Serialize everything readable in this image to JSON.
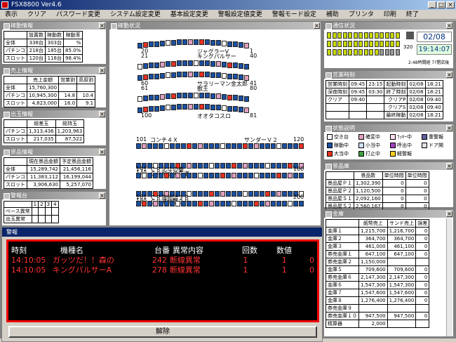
{
  "app": {
    "title": "FSX8800 Ver4.6"
  },
  "menu": [
    "表示",
    "クリア",
    "パスワード変更",
    "システム設定変更",
    "基本設定変更",
    "警報設定値変更",
    "警報モード設定",
    "補助",
    "プリンタ",
    "印刷",
    "終了"
  ],
  "kado": {
    "title": "稼動情報",
    "headers": [
      "",
      "設置数",
      "稼動数",
      "稼動率"
    ],
    "rows": [
      [
        "全体",
        "338台",
        "303台",
        "%"
      ],
      [
        "パチンコ",
        "218台",
        "185台",
        "85.0%"
      ],
      [
        "スロット",
        "120台",
        "118台",
        "98.4%"
      ]
    ]
  },
  "uriage": {
    "title": "売上情報",
    "headers": [
      "",
      "売上金額",
      "営業割",
      "高原割"
    ],
    "rows": [
      [
        "全体",
        "15,760,300",
        "",
        ""
      ],
      [
        "パチンコ",
        "10,945,300",
        "14.8",
        "10.4"
      ],
      [
        "スロット",
        "4,823,000",
        "16.0",
        "9.1"
      ]
    ]
  },
  "dedama": {
    "title": "出玉情報",
    "headers": [
      "",
      "総差玉",
      "総持玉"
    ],
    "rows": [
      [
        "パチンコ",
        "1,313,436",
        "1,203,963"
      ],
      [
        "スロット",
        "217,035",
        "87,522"
      ]
    ]
  },
  "keihin": {
    "title": "景品情報",
    "headers": [
      "",
      "現在景品金額",
      "予定景品金額"
    ],
    "rows": [
      [
        "全体",
        "15,289,742",
        "21,456,116"
      ],
      [
        "パチンコ",
        "11,383,112",
        "16,199,044"
      ],
      [
        "スロット",
        "3,906,630",
        "5,257,070"
      ]
    ]
  },
  "keiho": {
    "title": "警報台",
    "headers": [
      "",
      "1",
      "2",
      "3",
      "4"
    ],
    "rows": [
      [
        "ベース異常",
        "",
        "",
        "",
        ""
      ],
      [
        "出玉異常",
        "",
        "",
        "",
        ""
      ]
    ]
  },
  "floor": {
    "title": "稼動状況",
    "islands": [
      {
        "name": "ジャグラーV",
        "left": "20",
        "right": "1"
      },
      {
        "name": "キングパルサー",
        "left": "21",
        "right": "40"
      },
      {
        "name": "サラリーマン金太郎",
        "left": "60",
        "right": "41"
      },
      {
        "name": "獣王",
        "left": "61",
        "right": "80"
      },
      {
        "name": "オオタコスロ",
        "left": "100",
        "right": "81"
      }
    ],
    "rows": [
      {
        "left": "101",
        "name": "コンチ４Ｘ",
        "name2": "サンダーＶ２",
        "right": "120"
      },
      {
        "left": "140",
        "name": "ＣＲお水の花道",
        "right": ""
      },
      {
        "left": "141",
        "name": "ＣＲ北斗の拳",
        "right": "160"
      },
      {
        "left": "180",
        "name": "ＣＲ海物語３Ｒ",
        "right": ""
      },
      {
        "left": "181",
        "name": "ＣＲ海物語３Ｒ",
        "right": "200"
      }
    ]
  },
  "tsushin": {
    "title": "通信状況",
    "date": "02/08",
    "time": "19:14:07",
    "counter": "320",
    "labels": [
      "2:48時間経",
      "7?閉店後"
    ]
  },
  "eigyo": {
    "title": "営業時刻",
    "rows": [
      [
        "営業時刻",
        "09:45",
        "23:15",
        "起動時刻",
        "02/08",
        "18:21"
      ],
      [
        "深夜時刻",
        "09:45",
        "03:30",
        "終了時刻",
        "02/08",
        "18:21"
      ],
      [
        "クリア",
        "09:40",
        "",
        "クリアP",
        "02/08",
        "09:40"
      ],
      [
        "",
        "",
        "",
        "クリアS",
        "02/08",
        "09:40"
      ],
      [
        "",
        "",
        "",
        "最終稼動",
        "02/08",
        "18:21"
      ]
    ]
  },
  "jokyo": {
    "title": "状態説明",
    "items": [
      {
        "label": "空き台",
        "color": "#ffffff"
      },
      {
        "label": "確変中",
        "color": "#e0a0c0"
      },
      {
        "label": "ﾗｯｷｰ中",
        "color": "#ffe0f0"
      },
      {
        "label": "重警報",
        "color": "#6060a0"
      },
      {
        "label": "稼動中",
        "color": "#1a4fa0"
      },
      {
        "label": "小当中",
        "color": "#d0e0ff"
      },
      {
        "label": "呼出中",
        "color": "#a040c0"
      },
      {
        "label": "ドア開",
        "color": "#e0e0e0"
      },
      {
        "label": "大当中",
        "color": "#e83020"
      },
      {
        "label": "打止中",
        "color": "#40a040"
      },
      {
        "label": "軽警報",
        "color": "#ffd020"
      }
    ]
  },
  "keihinko": {
    "title": "景品庫",
    "headers": [
      "",
      "景品数",
      "単位時間",
      "単位時間"
    ],
    "rows": [
      [
        "景品屋Ｐ１",
        "1,302,390",
        "0",
        "0"
      ],
      [
        "景品屋Ｐ２",
        "1,120,500",
        "0",
        "0"
      ],
      [
        "景品屋Ｓ１",
        "2,092,160",
        "0",
        "0"
      ],
      [
        "景品屋Ｓ２",
        "2,560,167",
        "0",
        "0"
      ]
    ]
  },
  "kinko": {
    "title": "金庫",
    "headers": [
      "",
      "紙幣売上",
      "サンド売上",
      "誤差"
    ],
    "rows": [
      [
        "金庫１",
        "1,215,700",
        "1,216,700",
        "0"
      ],
      [
        "金庫２",
        "364,700",
        "364,700",
        "0"
      ],
      [
        "金庫３",
        "461,000",
        "461,100",
        "0"
      ],
      [
        "券売金庫１",
        "647,100",
        "647,100",
        "0"
      ],
      [
        "券売金庫２",
        "1,150,000",
        "",
        ""
      ],
      [
        "金庫５",
        "709,600",
        "709,600",
        "0"
      ],
      [
        "券売金庫６",
        "2,147,300",
        "2,147,300",
        "0"
      ],
      [
        "金庫６",
        "1,547,300",
        "1,547,300",
        "0"
      ],
      [
        "金庫７",
        "1,547,600",
        "1,547,600",
        "0"
      ],
      [
        "金庫８",
        "1,276,400",
        "1,276,400",
        "0"
      ],
      [
        "券売金庫９",
        "",
        "",
        ""
      ],
      [
        "券売金庫１０",
        "947,500",
        "947,500",
        "0"
      ],
      [
        "精算器",
        "2,000",
        "",
        ""
      ]
    ]
  },
  "alarm": {
    "title": "警報",
    "headers": [
      "時刻",
      "機種名",
      "台番",
      "異常内容",
      "回数",
      "数値"
    ],
    "rows": [
      [
        "14:10:05",
        "ガッツだ！！森の",
        "242",
        "断線異常",
        "1",
        "1",
        "0"
      ],
      [
        "14:10:05",
        "キングパルサーA",
        "278",
        "断線異常",
        "1",
        "1",
        "0"
      ]
    ],
    "button": "解除"
  }
}
